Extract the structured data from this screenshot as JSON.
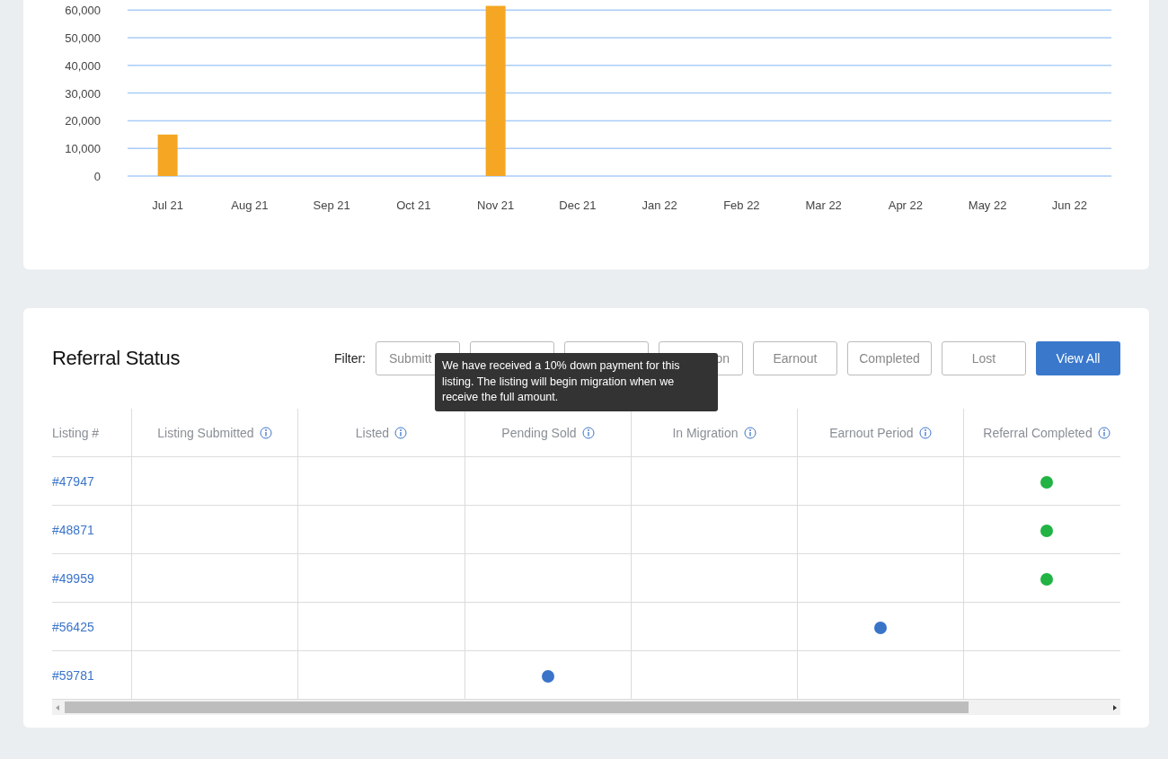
{
  "chart": {
    "chart_data": {
      "type": "bar",
      "categories": [
        "Jul 21",
        "Aug 21",
        "Sep 21",
        "Oct 21",
        "Nov 21",
        "Dec 21",
        "Jan 22",
        "Feb 22",
        "Mar 22",
        "Apr 22",
        "May 22",
        "Jun 22"
      ],
      "series": [
        {
          "color": "#f5a623",
          "values": [
            15000,
            0,
            0,
            0,
            61500,
            0,
            0,
            0,
            0,
            0,
            0,
            0
          ]
        }
      ],
      "ylim": [
        0,
        62000
      ],
      "grid": true,
      "yticks": [
        {
          "value": 0,
          "label": "0"
        },
        {
          "value": 10000,
          "label": "10,000"
        },
        {
          "value": 20000,
          "label": "20,000"
        },
        {
          "value": 30000,
          "label": "30,000"
        },
        {
          "value": 40000,
          "label": "40,000"
        },
        {
          "value": 50000,
          "label": "50,000"
        },
        {
          "value": 60000,
          "label": "60,000"
        }
      ]
    }
  },
  "referral_status": {
    "title": "Referral Status",
    "filter_label": "Filter:",
    "filters": [
      {
        "label": "Submitt",
        "under_tooltip": true
      },
      {
        "under_tooltip": true
      },
      {
        "under_tooltip": true
      },
      {
        "label": "on",
        "under_tooltip": true
      },
      {
        "label": "Earnout"
      },
      {
        "label": "Completed"
      },
      {
        "label": "Lost"
      }
    ],
    "view_all": "View All",
    "tooltip": "We have received a 10% down payment for this listing. The listing will begin migration when we receive the full amount.",
    "columns": [
      {
        "label": "Listing #",
        "info": false
      },
      {
        "label": "Listing Submitted",
        "info": true
      },
      {
        "label": "Listed",
        "info": true
      },
      {
        "label": "Pending Sold",
        "info": true
      },
      {
        "label": "In Migration",
        "info": true
      },
      {
        "label": "Earnout Period",
        "info": true
      },
      {
        "label": "Referral Completed",
        "info": true
      }
    ],
    "rows": [
      {
        "listing": "#47947",
        "stages": [
          false,
          false,
          false,
          false,
          false,
          true
        ],
        "color": "#21b343"
      },
      {
        "listing": "#48871",
        "stages": [
          false,
          false,
          false,
          false,
          false,
          true
        ],
        "color": "#21b343"
      },
      {
        "listing": "#49959",
        "stages": [
          false,
          false,
          false,
          false,
          false,
          true
        ],
        "color": "#21b343"
      },
      {
        "listing": "#56425",
        "stages": [
          false,
          false,
          false,
          false,
          true,
          false
        ],
        "color": "#3a74c9"
      },
      {
        "listing": "#59781",
        "stages": [
          false,
          false,
          true,
          false,
          false,
          false
        ],
        "color": "#3a74c9"
      }
    ]
  }
}
